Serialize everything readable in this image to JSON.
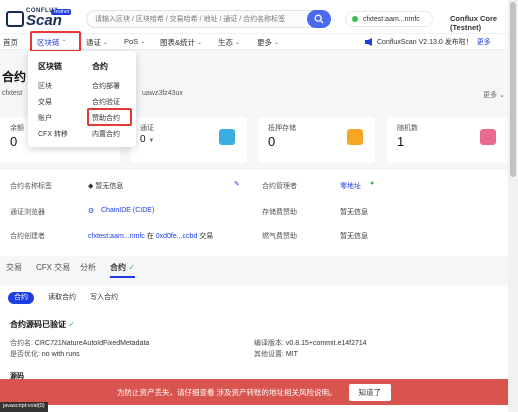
{
  "header": {
    "logo_top": "CONFLUX",
    "logo_main": "Scan",
    "logo_badge": "Testnet",
    "search_placeholder": "请输入区块 / 区块哈希 / 交易哈希 / 地址 / 通证 / 合约名称标签",
    "account": "cfxtest:aam...nmfc",
    "network": "Conflux Core (Testnet)"
  },
  "nav": {
    "home": "首页",
    "blockchain": "区块链",
    "tokens": "通证",
    "pos": "PoS",
    "charts": "图表&统计",
    "ecosystem": "生态",
    "more": "更多",
    "announcement": "ConfluxScan V2.13.0 发布啦！",
    "announcement_more": "更多"
  },
  "dropdown": {
    "col1_head": "区块链",
    "col1_items": [
      "区块",
      "交易",
      "账户",
      "CFX 转移"
    ],
    "col2_head": "合约",
    "col2_items": [
      "合约部署",
      "合约验证",
      "赞助合约",
      "内置合约"
    ]
  },
  "page": {
    "title": "合约",
    "address_prefix": "cfxtest",
    "address_tail": "uawz3fz43ux",
    "more": "更多"
  },
  "cards": [
    {
      "label": "余额",
      "value": "0",
      "icon": "balance-icon",
      "color": "#6a7cf0"
    },
    {
      "label": "通证",
      "value": "0",
      "icon": "token-icon",
      "color": "#3aaee0"
    },
    {
      "label": "抵押存储",
      "value": "0",
      "icon": "storage-icon",
      "color": "#f5a623"
    },
    {
      "label": "随机数",
      "value": "1",
      "icon": "nonce-icon",
      "color": "#e86a8e"
    }
  ],
  "info": {
    "name_tag_label": "合约名称标签",
    "name_tag_value": "暂无信息",
    "manager_label": "合约管理者",
    "manager_value": "零地址",
    "explorer_label": "通证浏览器",
    "explorer_value": "ChainIDE (CIDE)",
    "storage_sponsor_label": "存储费赞助",
    "storage_sponsor_value": "暂无信息",
    "creator_label": "合约创建者",
    "creator_addr": "cfxtest:aam...nmfc",
    "creator_mid": "在",
    "creator_tx": "0xd0fe...ccbd",
    "creator_suffix": "交易",
    "gas_sponsor_label": "燃气费赞助",
    "gas_sponsor_value": "暂无信息"
  },
  "tabs": {
    "t1": "交易",
    "t2": "CFX 交易",
    "t3": "分析",
    "t4": "合约"
  },
  "panel": {
    "pill1": "合约",
    "pill2": "读取合约",
    "pill3": "写入合约",
    "title": "合约源码已验证",
    "name_label": "合约名:",
    "name_value": "CRC721NatureAutoIdFixedMetadata",
    "opt_label": "是否优化:",
    "opt_value": "no with runs",
    "compiler_label": "编译版本:",
    "compiler_value": "v0.8.15+commit.e14f2714",
    "license_label": "其他设置:",
    "license_value": "MIT",
    "source_label": "源码"
  },
  "cookie": {
    "text": "为防止资产丢失，请仔细查看 涉及资产转账的地址相关风险说明。",
    "button": "知道了"
  },
  "statusbar": "javascript:void(0)"
}
